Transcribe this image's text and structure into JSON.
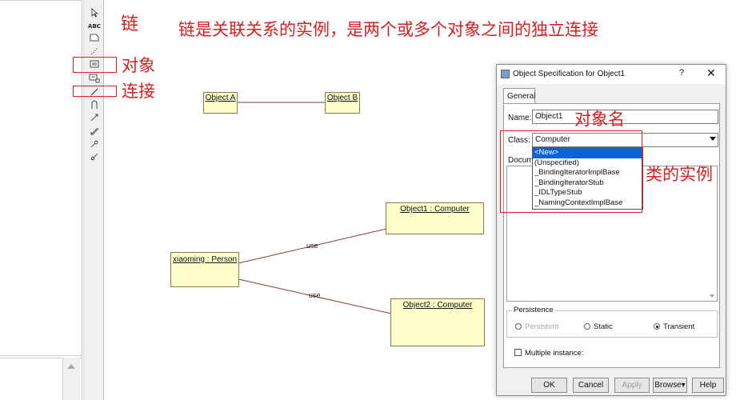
{
  "annotations": {
    "heading_link": "链",
    "heading_desc": "链是关联关系的实例，是两个或多个对象之间的独立连接",
    "label_object": "对象",
    "label_connect": "连接",
    "label_object_name": "对象名",
    "label_class_instance": "类的实例",
    "accent_color": "#d91f1f"
  },
  "toolbox": {
    "items": [
      "pointer-icon",
      "text-tool",
      "note-icon",
      "anchor-note-icon",
      "object-icon",
      "class-instance-icon",
      "link-icon",
      "self-link-icon",
      "message-icon",
      "reverse-message-icon",
      "data-flow-icon",
      "reverse-data-flow-icon"
    ],
    "abc_label": "ABC"
  },
  "diagram": {
    "object_a": "Object A",
    "object_b": "Object B",
    "object1": "Object1 : Computer",
    "object2": "Object2 : Computer",
    "person": "xiaoming : Person",
    "link_label_1": "use",
    "link_label_2": "use",
    "box_fill": "#ffffcc",
    "link_color": "#8b3a3a"
  },
  "dialog": {
    "title": "Object Specification for Object1",
    "help": "?",
    "close": "✕",
    "tab_general": "General",
    "name_label": "Name:",
    "name_value": "Object1",
    "class_label": "Class:",
    "class_value": "Computer",
    "doc_label": "Docum",
    "class_options": [
      "<New>",
      "(Unspecified)",
      "_BindingIteratorImplBase",
      "_BindingIteratorStub",
      "_IDLTypeStub",
      "_NamingContextImplBase"
    ],
    "persistence_label": "Persistence",
    "radio_persistent": "Persistent",
    "radio_static": "Static",
    "radio_transient": "Transient",
    "multiple_instances": "Multiple instance:",
    "buttons": {
      "ok": "OK",
      "cancel": "Cancel",
      "apply": "Apply",
      "browse": "Browse▾",
      "help": "Help"
    }
  }
}
